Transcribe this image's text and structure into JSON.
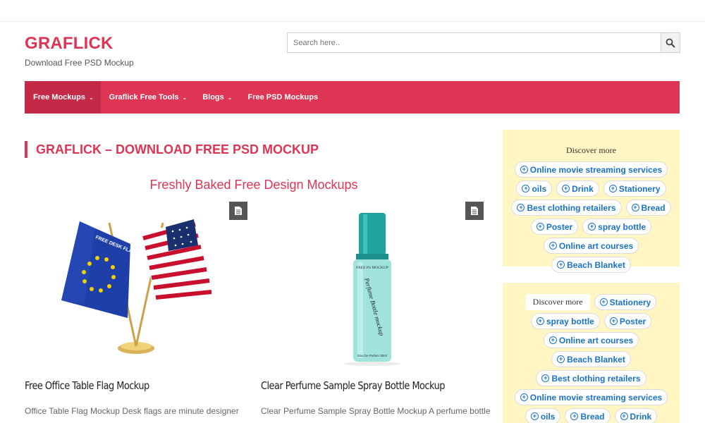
{
  "site": {
    "brand": "GRAFLICK",
    "tagline": "Download Free PSD Mockup"
  },
  "search": {
    "placeholder": "Search here.."
  },
  "nav": [
    {
      "label": "Free Mockups",
      "dropdown": true,
      "active": true
    },
    {
      "label": "Graflick Free Tools",
      "dropdown": true
    },
    {
      "label": "Blogs",
      "dropdown": true
    },
    {
      "label": "Free PSD Mockups",
      "dropdown": false
    }
  ],
  "main": {
    "page_title": "GRAFLICK – DOWNLOAD FREE PSD MOCKUP",
    "subheading": "Freshly Baked Free Design Mockups",
    "cards": [
      {
        "title": "Free Office Table Flag Mockup",
        "excerpt": "Office Table Flag Mockup Desk flags are minute designer",
        "flag_text": "FREE DESK FLAG MOCKUP"
      },
      {
        "title": "Clear Perfume Sample Spray Bottle Mockup",
        "excerpt": "Clear Perfume Sample Spray Bottle Mockup A perfume bottle",
        "bottle_label": "FREE PS MOCKUP",
        "bottle_script": "Perfume Bottle mockup",
        "bottle_foot": "Eau De Parfum 30ml"
      }
    ]
  },
  "sidebar": {
    "box1": {
      "label": "Discover more",
      "chips": [
        "Online movie streaming services",
        "oils",
        "Drink",
        "Stationery",
        "Best clothing retailers",
        "Bread",
        "Poster",
        "spray bottle",
        "Online art courses",
        "Beach Blanket"
      ]
    },
    "box2": {
      "label": "Discover more",
      "chips": [
        "Stationery",
        "spray bottle",
        "Poster",
        "Online art courses",
        "Beach Blanket",
        "Best clothing retailers",
        "Online movie streaming services",
        "oils",
        "Bread",
        "Drink"
      ]
    }
  },
  "colors": {
    "accent": "#de3554",
    "nav_active": "#c42a48",
    "chip_text": "#1a73c8",
    "sidebar_bg": "#fff6c4"
  }
}
